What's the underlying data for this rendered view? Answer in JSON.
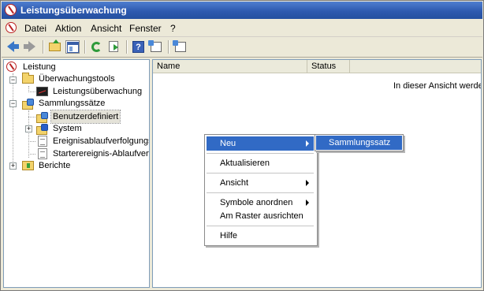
{
  "window": {
    "title": "Leistungsüberwachung"
  },
  "menubar": {
    "items": [
      "Datei",
      "Aktion",
      "Ansicht",
      "Fenster",
      "?"
    ]
  },
  "toolbar": {
    "buttons": [
      "back-icon",
      "forward-icon",
      "up-folder-icon",
      "show-hide-tree-icon",
      "refresh-icon",
      "export-list-icon",
      "help-icon",
      "properties-icon",
      "new-window-icon"
    ]
  },
  "tree": {
    "root": "Leistung",
    "monitoring_tools": "Überwachungstools",
    "performance_monitor": "Leistungsüberwachung",
    "collection_sets": "Sammlungssätze",
    "user_defined": "Benutzerdefiniert",
    "system": "System",
    "event_trace": "Ereignisablaufverfolgungs",
    "startup_event": "Starterereignis-Ablaufverfo",
    "reports": "Berichte"
  },
  "list": {
    "columns": [
      "Name",
      "Status"
    ],
    "empty_message": "In dieser Ansicht werden"
  },
  "context_menu": {
    "new": "Neu",
    "refresh": "Aktualisieren",
    "view": "Ansicht",
    "arrange_icons": "Symbole anordnen",
    "align_grid": "Am Raster ausrichten",
    "help": "Hilfe"
  },
  "submenu": {
    "collection_set": "Sammlungssatz"
  },
  "colors": {
    "title_bar": "#2e5ab0",
    "highlight": "#316ac5",
    "chrome": "#ece9d8"
  }
}
